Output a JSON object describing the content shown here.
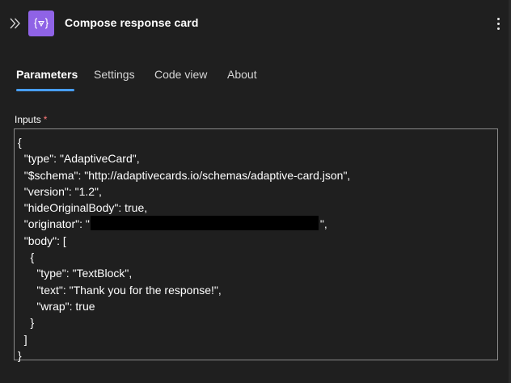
{
  "header": {
    "title": "Compose response card",
    "collapse_icon": "double-chevron-right-icon",
    "action_icon": "data-operation-icon",
    "action_icon_glyph": "{ }",
    "action_icon_color": "#8f63e6",
    "more_icon": "more-vertical-icon"
  },
  "tabs": [
    {
      "label": "Parameters",
      "active": true
    },
    {
      "label": "Settings",
      "active": false
    },
    {
      "label": "Code view",
      "active": false
    },
    {
      "label": "About",
      "active": false
    }
  ],
  "accent_color": "#479ef5",
  "inputs": {
    "label": "Inputs",
    "required_mark": "*",
    "code_lines": [
      "{",
      "  \"type\": \"AdaptiveCard\",",
      "  \"$schema\": \"http://adaptivecards.io/schemas/adaptive-card.json\",",
      "  \"version\": \"1.2\",",
      "  \"hideOriginalBody\": true,",
      "  \"originator\": \"",
      "  \"body\": [",
      "    {",
      "      \"type\": \"TextBlock\",",
      "      \"text\": \"Thank you for the response!\",",
      "      \"wrap\": true",
      "    }",
      "  ]",
      "}"
    ],
    "originator_suffix": "\","
  }
}
